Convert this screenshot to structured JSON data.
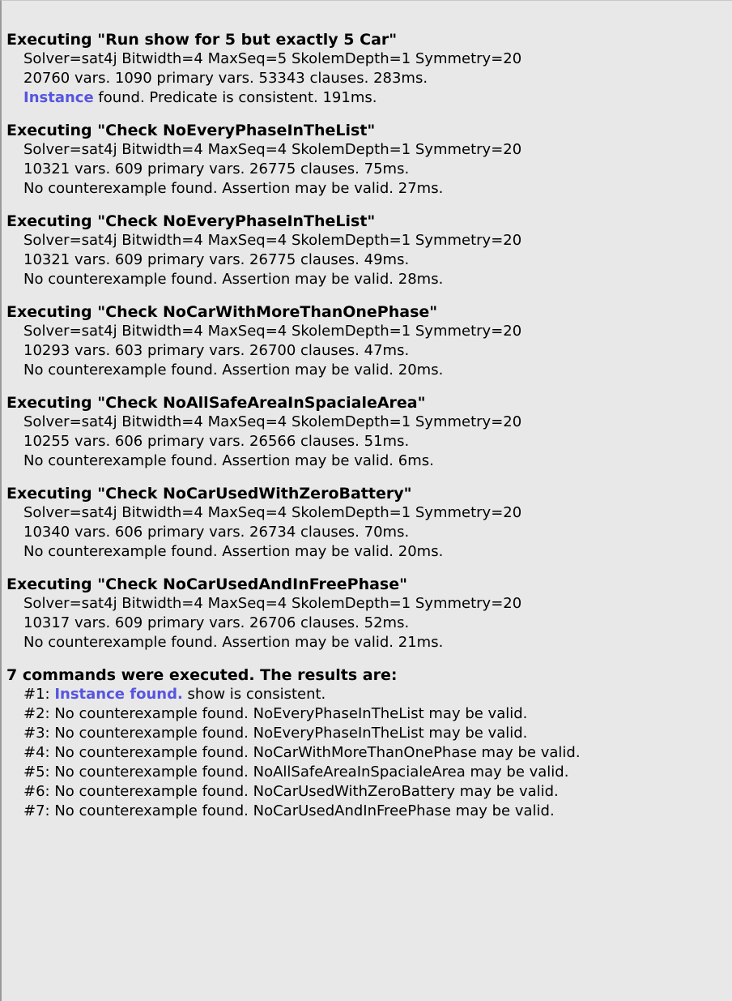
{
  "executions": [
    {
      "title": "Executing \"Run show for 5 but exactly 5 Car\"",
      "solver": "Solver=sat4j Bitwidth=4 MaxSeq=5 SkolemDepth=1 Symmetry=20",
      "stats": "20760 vars. 1090 primary vars. 53343 clauses. 283ms.",
      "result_link": "Instance",
      "result_text": " found. Predicate is consistent. 191ms."
    },
    {
      "title": "Executing \"Check NoEveryPhaseInTheList\"",
      "solver": "Solver=sat4j Bitwidth=4 MaxSeq=4 SkolemDepth=1 Symmetry=20",
      "stats": "10321 vars. 609 primary vars. 26775 clauses. 75ms.",
      "result_text": "No counterexample found. Assertion may be valid. 27ms."
    },
    {
      "title": "Executing \"Check NoEveryPhaseInTheList\"",
      "solver": "Solver=sat4j Bitwidth=4 MaxSeq=4 SkolemDepth=1 Symmetry=20",
      "stats": "10321 vars. 609 primary vars. 26775 clauses. 49ms.",
      "result_text": "No counterexample found. Assertion may be valid. 28ms."
    },
    {
      "title": "Executing \"Check NoCarWithMoreThanOnePhase\"",
      "solver": "Solver=sat4j Bitwidth=4 MaxSeq=4 SkolemDepth=1 Symmetry=20",
      "stats": "10293 vars. 603 primary vars. 26700 clauses. 47ms.",
      "result_text": "No counterexample found. Assertion may be valid. 20ms."
    },
    {
      "title": "Executing \"Check NoAllSafeAreaInSpacialeArea\"",
      "solver": "Solver=sat4j Bitwidth=4 MaxSeq=4 SkolemDepth=1 Symmetry=20",
      "stats": "10255 vars. 606 primary vars. 26566 clauses. 51ms.",
      "result_text": "No counterexample found. Assertion may be valid. 6ms."
    },
    {
      "title": "Executing \"Check NoCarUsedWithZeroBattery\"",
      "solver": "Solver=sat4j Bitwidth=4 MaxSeq=4 SkolemDepth=1 Symmetry=20",
      "stats": "10340 vars. 606 primary vars. 26734 clauses. 70ms.",
      "result_text": "No counterexample found. Assertion may be valid. 20ms."
    },
    {
      "title": "Executing \"Check NoCarUsedAndInFreePhase\"",
      "solver": "Solver=sat4j Bitwidth=4 MaxSeq=4 SkolemDepth=1 Symmetry=20",
      "stats": "10317 vars. 609 primary vars. 26706 clauses. 52ms.",
      "result_text": "No counterexample found. Assertion may be valid. 21ms."
    }
  ],
  "summary": {
    "title": "7 commands were executed. The results are:",
    "results": [
      {
        "prefix": "#1: ",
        "link": "Instance found.",
        "text": " show is consistent."
      },
      {
        "prefix": "#2: ",
        "text": "No counterexample found. NoEveryPhaseInTheList may be valid."
      },
      {
        "prefix": "#3: ",
        "text": "No counterexample found. NoEveryPhaseInTheList may be valid."
      },
      {
        "prefix": "#4: ",
        "text": "No counterexample found. NoCarWithMoreThanOnePhase may be valid."
      },
      {
        "prefix": "#5: ",
        "text": "No counterexample found. NoAllSafeAreaInSpacialeArea may be valid."
      },
      {
        "prefix": "#6: ",
        "text": "No counterexample found. NoCarUsedWithZeroBattery may be valid."
      },
      {
        "prefix": "#7: ",
        "text": "No counterexample found. NoCarUsedAndInFreePhase may be valid."
      }
    ]
  },
  "colors": {
    "link": "#5755e0",
    "background": "#e8e8e8"
  }
}
